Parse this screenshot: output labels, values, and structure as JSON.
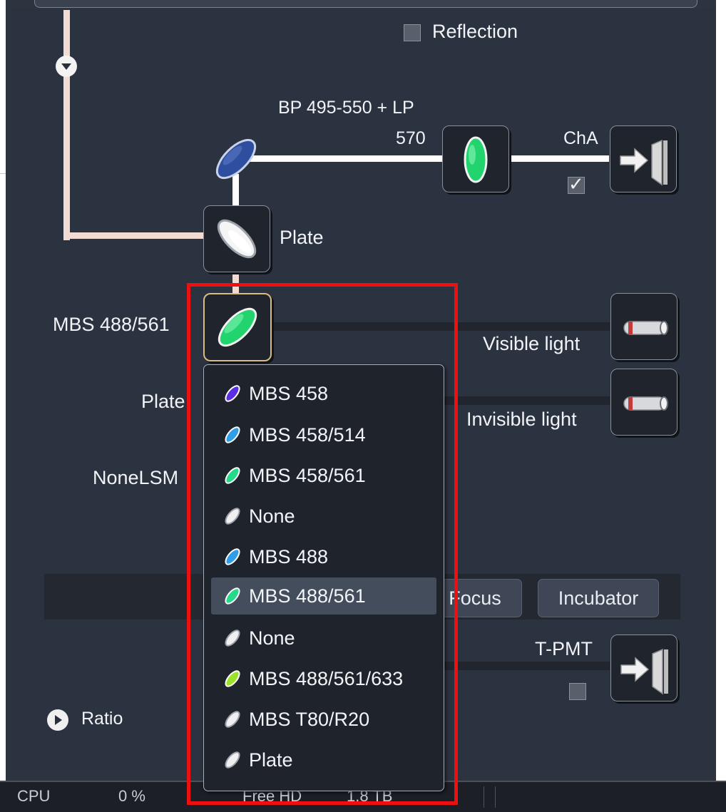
{
  "lightpath": {
    "reflection_label": "Reflection",
    "reflection_checked": false,
    "emission_filter_label_line1": "BP 495-550 + LP",
    "emission_filter_label_line2": "570",
    "channel_a_label": "ChA",
    "channel_a_checked": true,
    "plate_label": "Plate",
    "main_beam_splitter_label": "MBS 488/561",
    "plate_row_label": "Plate",
    "none_lsm_label": "NoneLSM",
    "visible_light_label": "Visible light",
    "invisible_light_label": "Invisible light",
    "tpmt_label": "T-PMT",
    "tpmt_checked": false,
    "ratio_label": "Ratio"
  },
  "tool_strip": {
    "focus_label": "Focus",
    "incubator_label": "Incubator"
  },
  "mbs_dropdown": {
    "selected": "MBS 488/561",
    "items": [
      {
        "label": "MBS 458",
        "color": "#5a2ee6"
      },
      {
        "label": "MBS 458/514",
        "color": "#2f9de8"
      },
      {
        "label": "MBS 458/561",
        "color": "#25d98a"
      },
      {
        "label": "None",
        "color": "#f0f0f0"
      },
      {
        "label": "MBS 488",
        "color": "#2f9de8"
      },
      {
        "label": "MBS 488/561",
        "color": "#25d98a"
      },
      {
        "label": "None",
        "color": "#f0f0f0"
      },
      {
        "label": "MBS 488/561/633",
        "color": "#9be32a"
      },
      {
        "label": "MBS T80/R20",
        "color": "#f0f0f0"
      },
      {
        "label": "Plate",
        "color": "#f0f0f0"
      }
    ]
  },
  "status_bar": {
    "cpu_label": "CPU",
    "cpu_value": "0 %",
    "free_hd_label": "Free HD",
    "free_hd_value": "1.8 TB"
  },
  "colors": {
    "panel_bg": "#2b3240",
    "selection_border": "#d9bd82",
    "highlight_box": "#ee1010",
    "green_filter": "#22d46e",
    "blue_mirror": "#2e4fa0"
  },
  "icons": {
    "expand": "chevron-down-circle-icon",
    "detector": "detector-arrow-icon",
    "laser": "laser-tube-icon",
    "ratio": "play-circle-icon"
  }
}
